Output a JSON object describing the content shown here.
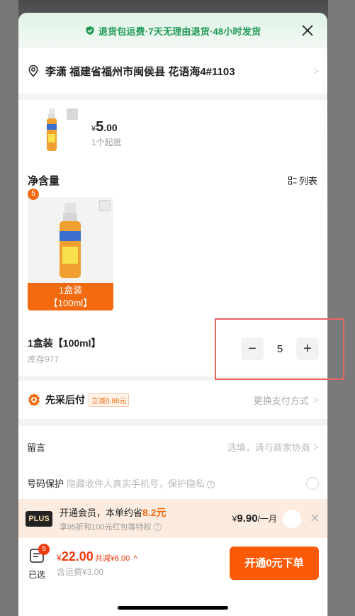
{
  "banner": {
    "text": "退货包运费·7天无理由退货·48小时发货",
    "color": "#1f9a55"
  },
  "address": {
    "text": "李潇 福建省福州市闽侯县 花语海4#1103"
  },
  "product": {
    "currency": "¥",
    "price_int": "5",
    "price_dec": ".00",
    "moq": "1个起批",
    "spec_title": "净含量",
    "list_toggle": "列表",
    "option": {
      "badge": "5",
      "label_line1": "1盒装",
      "label_line2": "【100ml】",
      "accent": "#f26a0f"
    },
    "selected_name": "1盒装【100ml】",
    "stock": "库存977",
    "quantity": "5",
    "minus": "−",
    "plus": "+"
  },
  "payment": {
    "label": "先采后付",
    "discount": "立减0.88元",
    "change": "更换支付方式"
  },
  "message": {
    "label": "留言",
    "placeholder": "选填，请与商家协商"
  },
  "phone_protect": {
    "label": "号码保护",
    "hint": "隐藏收件人真实手机号，保护隐私"
  },
  "plus_member": {
    "badge": "PLUS",
    "title_prefix": "开通会员，本单约省",
    "save_amount": "8.2元",
    "subtitle": "享95折和100元红包等特权",
    "price_cur": "¥",
    "price": "9.90",
    "period": "/一月"
  },
  "footer": {
    "cart_badge": "5",
    "cart_label": "已选",
    "total_cur": "¥",
    "total": "22.00",
    "discount": "共减¥6.00",
    "shipping": "含运费¥3.00",
    "order_button": "开通0元下单",
    "accent": "#fb5a06"
  }
}
